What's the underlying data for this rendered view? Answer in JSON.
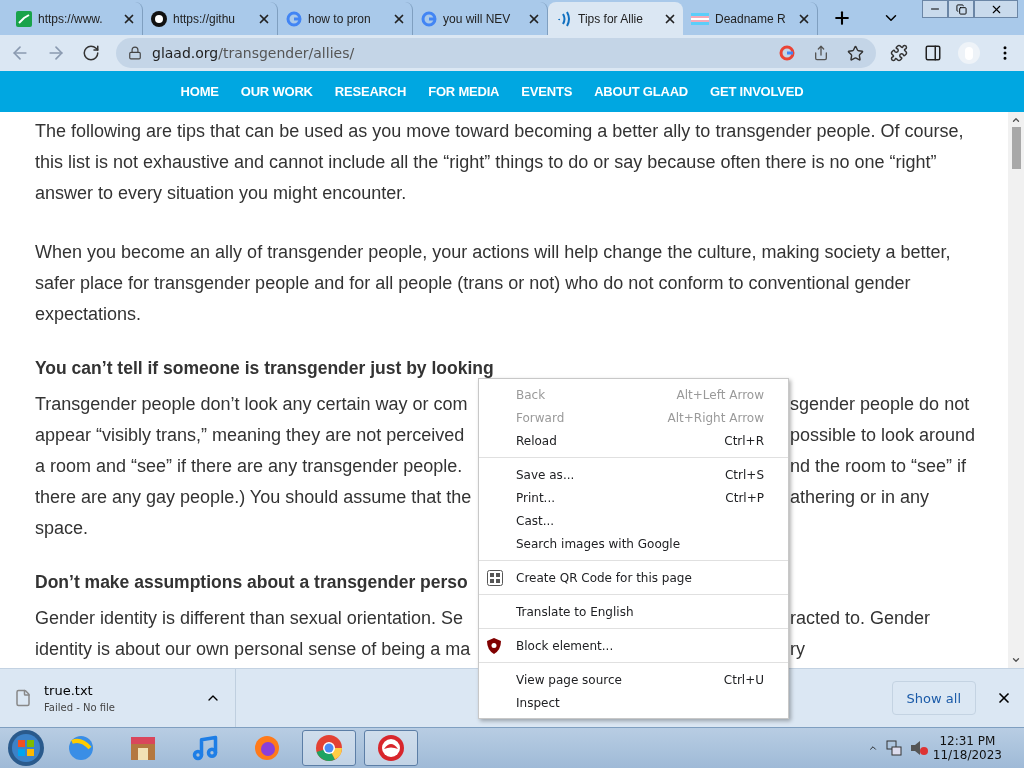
{
  "tabs": [
    {
      "title": "https://www.",
      "selected": false
    },
    {
      "title": "https://githu",
      "selected": false
    },
    {
      "title": "how to pron",
      "selected": false
    },
    {
      "title": "you will NEV",
      "selected": false
    },
    {
      "title": "Tips for Allie",
      "selected": true
    },
    {
      "title": "Deadname R",
      "selected": false
    }
  ],
  "address": {
    "host": "glaad.org",
    "path": "/transgender/allies/"
  },
  "site_nav": [
    "HOME",
    "OUR WORK",
    "RESEARCH",
    "FOR MEDIA",
    "EVENTS",
    "ABOUT GLAAD",
    "GET INVOLVED"
  ],
  "paragraphs": [
    "The following are tips that can be used as you move toward becoming a better ally to transgender people. Of course, this list is not exhaustive and cannot include all the “right” things to do or say because often there is no one “right” answer to every situation you might encounter.",
    "When you become an ally of transgender people, your actions will help change the culture, making society a better, safer place for transgender people and for all people (trans or not) who do not conform to conventional gender expectations."
  ],
  "sections": [
    {
      "heading": "You can’t tell if someone is transgender just by looking",
      "lines": [
        {
          "left": "Transgender people don’t look any certain way or com",
          "right": "sgender people do not"
        },
        {
          "left": "appear “visibly trans,” meaning they are not perceived",
          "right": "possible to look around"
        },
        {
          "left": "a room and “see” if there are any transgender people.",
          "right": "nd the room to “see” if"
        },
        {
          "left": "there are any gay people.) You should assume that the",
          "right": "athering or in any"
        },
        {
          "left": "space."
        }
      ]
    },
    {
      "heading": "Don’t make assumptions about a transgender perso",
      "lines": [
        {
          "left": "Gender identity is different than sexual orientation. Se",
          "right": "racted to. Gender"
        },
        {
          "left": "identity is about our own personal sense of being a ma",
          "right": "ry"
        }
      ]
    }
  ],
  "context_menu": [
    [
      {
        "label": "Back",
        "shortcut": "Alt+Left Arrow",
        "disabled": true,
        "kind": "plain"
      },
      {
        "label": "Forward",
        "shortcut": "Alt+Right Arrow",
        "disabled": true,
        "kind": "plain"
      },
      {
        "label": "Reload",
        "shortcut": "Ctrl+R",
        "disabled": false,
        "kind": "plain"
      }
    ],
    [
      {
        "label": "Save as...",
        "shortcut": "Ctrl+S",
        "disabled": false,
        "kind": "plain"
      },
      {
        "label": "Print...",
        "shortcut": "Ctrl+P",
        "disabled": false,
        "kind": "plain"
      },
      {
        "label": "Cast...",
        "disabled": false,
        "kind": "plain"
      },
      {
        "label": "Search images with Google",
        "disabled": false,
        "kind": "plain"
      }
    ],
    [
      {
        "label": "Create QR Code for this page",
        "disabled": false,
        "kind": "qr"
      }
    ],
    [
      {
        "label": "Translate to English",
        "disabled": false,
        "kind": "plain"
      }
    ],
    [
      {
        "label": "Block element...",
        "disabled": false,
        "kind": "shield"
      }
    ],
    [
      {
        "label": "View page source",
        "shortcut": "Ctrl+U",
        "disabled": false,
        "kind": "plain"
      },
      {
        "label": "Inspect",
        "disabled": false,
        "kind": "plain"
      }
    ]
  ],
  "download": {
    "file": "true.txt",
    "status": "Failed - No file",
    "show_all": "Show all"
  },
  "taskbar": {
    "apps": [
      {
        "selected": false
      },
      {
        "selected": false
      },
      {
        "selected": false
      },
      {
        "selected": false
      },
      {
        "selected": true
      },
      {
        "selected": true
      }
    ],
    "time": "12:31 PM",
    "date": "11/18/2023"
  }
}
